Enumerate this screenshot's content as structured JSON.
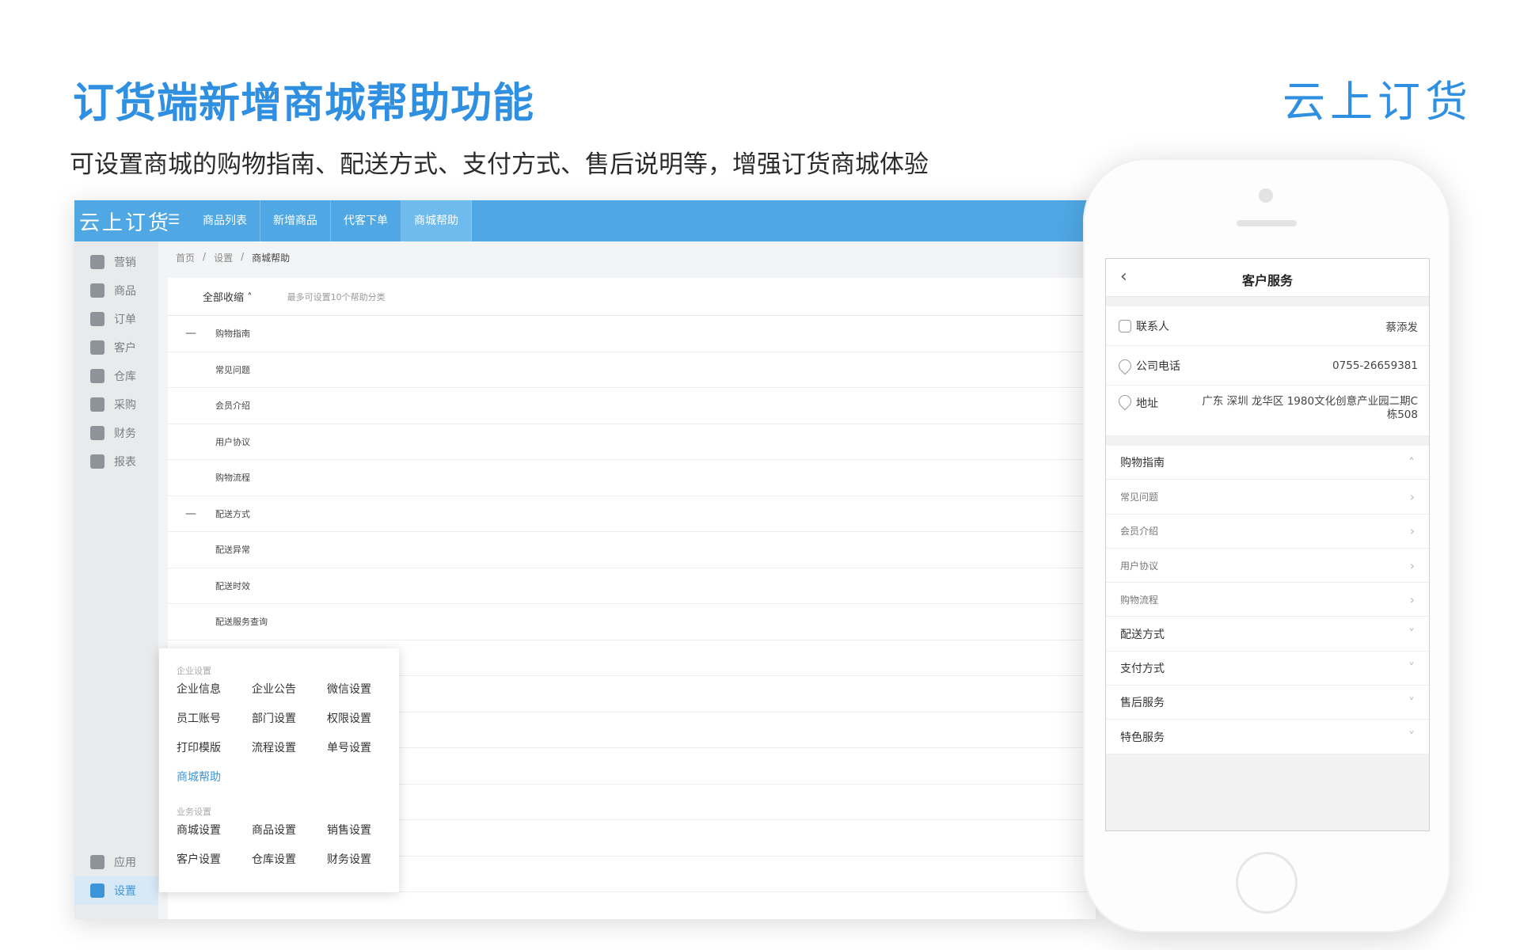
{
  "hero": {
    "title": "订货端新增商城帮助功能",
    "subtitle": "可设置商城的购物指南、配送方式、支付方式、售后说明等，增强订货商城体验",
    "brand": "云上订货"
  },
  "admin": {
    "logo": "云上订货",
    "tabs": [
      "商品列表",
      "新增商品",
      "代客下单",
      "商城帮助"
    ],
    "sidebar": {
      "top": [
        {
          "label": "营销",
          "icon": "megaphone-icon"
        },
        {
          "label": "商品",
          "icon": "box-icon"
        },
        {
          "label": "订单",
          "icon": "order-icon"
        },
        {
          "label": "客户",
          "icon": "building-icon"
        },
        {
          "label": "仓库",
          "icon": "warehouse-icon"
        },
        {
          "label": "采购",
          "icon": "basket-icon"
        },
        {
          "label": "财务",
          "icon": "money-bag-icon"
        },
        {
          "label": "报表",
          "icon": "chart-icon"
        }
      ],
      "bottom": [
        {
          "label": "应用",
          "icon": "cube-icon"
        },
        {
          "label": "设置",
          "icon": "gear-icon"
        }
      ]
    },
    "breadcrumb": [
      "首页",
      "/",
      "设置",
      "/",
      "商城帮助"
    ],
    "content": {
      "collapse_all": "全部收缩 ˄",
      "hint": "最多可设置10个帮助分类",
      "groups": [
        {
          "name": "购物指南",
          "marker": "—",
          "children": [
            "常见问题",
            "会员介绍",
            "用户协议",
            "购物流程"
          ]
        },
        {
          "name": "配送方式",
          "marker": "—",
          "children": [
            "配送异常",
            "配送时效",
            "配送服务查询"
          ]
        }
      ]
    },
    "popup": {
      "section1": "企业设置",
      "items1": [
        "企业信息",
        "企业公告",
        "微信设置",
        "员工账号",
        "部门设置",
        "权限设置",
        "打印模版",
        "流程设置",
        "单号设置",
        "商城帮助"
      ],
      "section2": "业务设置",
      "items2": [
        "商城设置",
        "商品设置",
        "销售设置",
        "客户设置",
        "仓库设置",
        "财务设置"
      ]
    }
  },
  "phone": {
    "title": "客户服务",
    "back_icon": "‹",
    "contact": {
      "label": "联系人",
      "value": "蔡添发"
    },
    "phone": {
      "label": "公司电话",
      "value": "0755-26659381"
    },
    "address": {
      "label": "地址",
      "value": "广东 深圳 龙华区 1980文化创意产业园二期C栋508"
    },
    "menu": [
      {
        "label": "购物指南",
        "chev": "˄",
        "sub": false
      },
      {
        "label": "常见问题",
        "chev": "›",
        "sub": true
      },
      {
        "label": "会员介绍",
        "chev": "›",
        "sub": true
      },
      {
        "label": "用户协议",
        "chev": "›",
        "sub": true
      },
      {
        "label": "购物流程",
        "chev": "›",
        "sub": true
      },
      {
        "label": "配送方式",
        "chev": "˅",
        "sub": false
      },
      {
        "label": "支付方式",
        "chev": "˅",
        "sub": false
      },
      {
        "label": "售后服务",
        "chev": "˅",
        "sub": false
      },
      {
        "label": "特色服务",
        "chev": "˅",
        "sub": false
      }
    ]
  },
  "colors": {
    "accent": "#4fa8e4",
    "headline": "#2f8fe0",
    "selected": "#3c95d9"
  }
}
